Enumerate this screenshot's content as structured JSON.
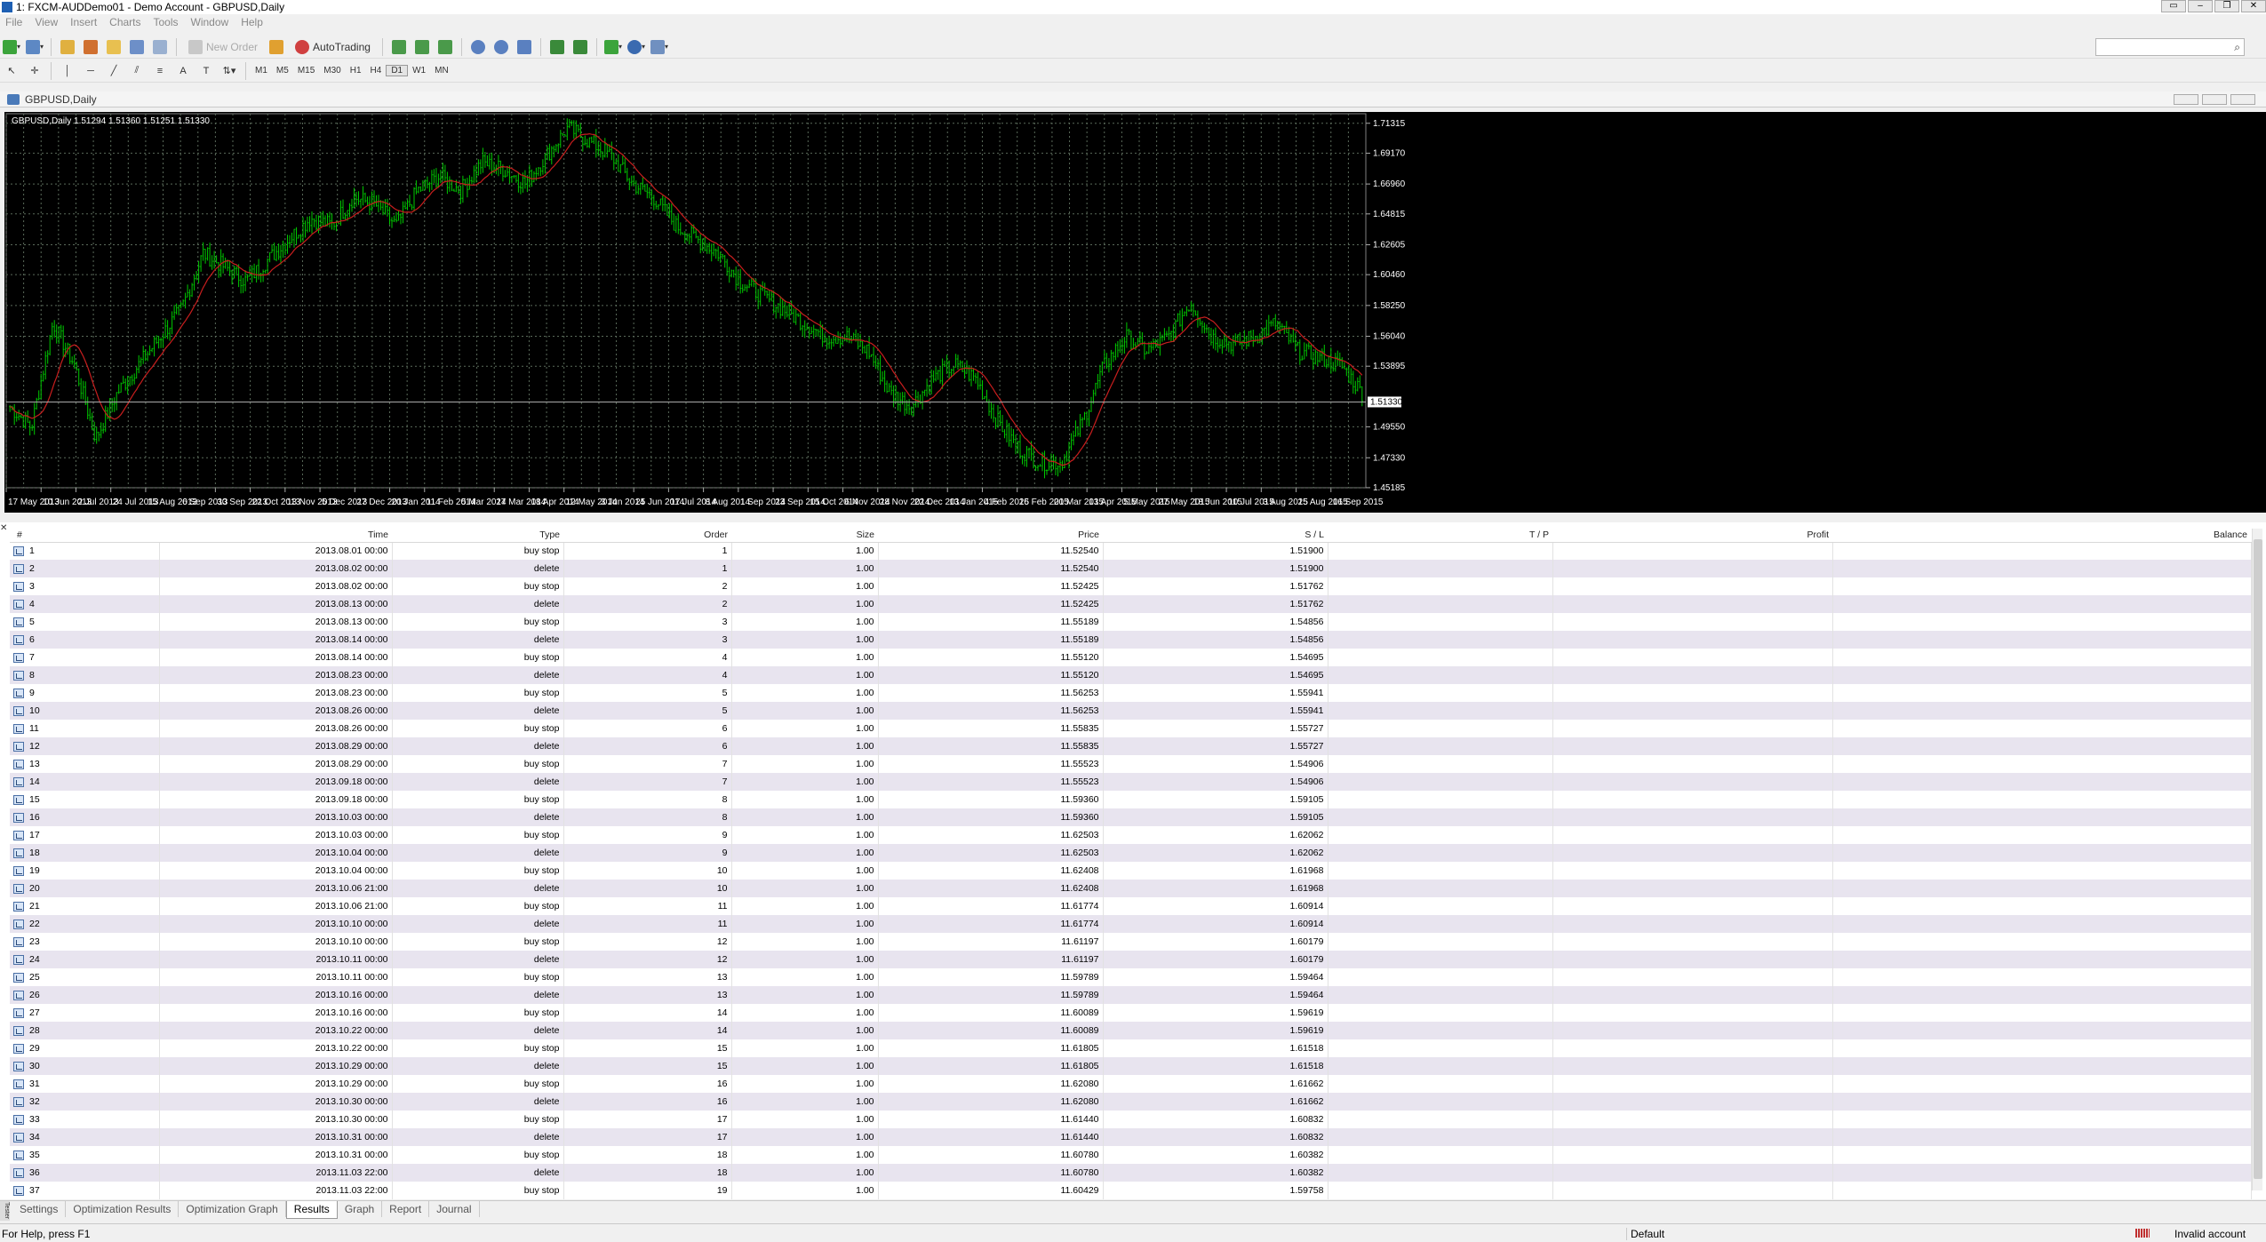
{
  "window": {
    "title": "1: FXCM-AUDDemo01 - Demo Account - GBPUSD,Daily",
    "buttons": [
      "▭",
      "–",
      "❐",
      "✕"
    ]
  },
  "menu": [
    "File",
    "View",
    "Insert",
    "Charts",
    "Tools",
    "Window",
    "Help"
  ],
  "toolbar1": {
    "new_order_label": "New Order",
    "autotrading_label": "AutoTrading"
  },
  "toolbar2": {
    "timeframes": [
      "M1",
      "M5",
      "M15",
      "M30",
      "H1",
      "H4",
      "D1",
      "W1",
      "MN"
    ],
    "active_timeframe": "D1"
  },
  "chart": {
    "window_title": "GBPUSD,Daily",
    "ohlc_label": "GBPUSD,Daily  1.51294 1.51360 1.51251 1.51330",
    "current_price": "1.51330",
    "price_labels": [
      "1.71315",
      "1.69170",
      "1.66960",
      "1.64815",
      "1.62605",
      "1.60460",
      "1.58250",
      "1.56040",
      "1.53895",
      "1.49550",
      "1.47330",
      "1.45185"
    ],
    "date_labels": [
      "17 May 2013",
      "10 Jun 2013",
      "2 Jul 2013",
      "24 Jul 2013",
      "15 Aug 2013",
      "6 Sep 2013",
      "30 Sep 2013",
      "22 Oct 2013",
      "13 Nov 2013",
      "5 Dec 2013",
      "27 Dec 2013",
      "20 Jan 2014",
      "11 Feb 2014",
      "5 Mar 2014",
      "27 Mar 2014",
      "18 Apr 2014",
      "12 May 2014",
      "3 Jun 2014",
      "25 Jun 2014",
      "17 Jul 2014",
      "8 Aug 2014",
      "1 Sep 2014",
      "23 Sep 2014",
      "15 Oct 2014",
      "6 Nov 2014",
      "28 Nov 2014",
      "22 Dec 2014",
      "13 Jan 2015",
      "4 Feb 2015",
      "26 Feb 2015",
      "20 Mar 2015",
      "13 Apr 2015",
      "5 May 2015",
      "27 May 2015",
      "18 Jun 2015",
      "10 Jul 2015",
      "3 Aug 2015",
      "25 Aug 2015",
      "16 Sep 2015"
    ],
    "price_min": 1.4518,
    "price_max": 1.72,
    "colors": {
      "background": "#000000",
      "bars": "#00c800",
      "ma_line": "#c81e1e",
      "grid": "#5a6a5a"
    },
    "series_keypoints": [
      1.51,
      1.495,
      1.57,
      1.54,
      1.487,
      1.52,
      1.54,
      1.56,
      1.58,
      1.62,
      1.61,
      1.6,
      1.615,
      1.63,
      1.645,
      1.64,
      1.66,
      1.655,
      1.64,
      1.665,
      1.675,
      1.665,
      1.685,
      1.68,
      1.67,
      1.69,
      1.71,
      1.7,
      1.69,
      1.67,
      1.66,
      1.64,
      1.63,
      1.62,
      1.6,
      1.59,
      1.58,
      1.57,
      1.56,
      1.56,
      1.55,
      1.52,
      1.51,
      1.53,
      1.54,
      1.53,
      1.5,
      1.48,
      1.47,
      1.47,
      1.5,
      1.54,
      1.56,
      1.55,
      1.56,
      1.585,
      1.56,
      1.555,
      1.56,
      1.57,
      1.55,
      1.545,
      1.54,
      1.52
    ]
  },
  "results": {
    "columns": [
      "#",
      "Time",
      "Type",
      "Order",
      "Size",
      "Price",
      "S / L",
      "T / P",
      "Profit",
      "Balance"
    ],
    "rows": [
      [
        "1",
        "2013.08.01 00:00",
        "buy stop",
        "1",
        "1.00",
        "11.52540",
        "1.51900",
        "",
        "",
        ""
      ],
      [
        "2",
        "2013.08.02 00:00",
        "delete",
        "1",
        "1.00",
        "11.52540",
        "1.51900",
        "",
        "",
        ""
      ],
      [
        "3",
        "2013.08.02 00:00",
        "buy stop",
        "2",
        "1.00",
        "11.52425",
        "1.51762",
        "",
        "",
        ""
      ],
      [
        "4",
        "2013.08.13 00:00",
        "delete",
        "2",
        "1.00",
        "11.52425",
        "1.51762",
        "",
        "",
        ""
      ],
      [
        "5",
        "2013.08.13 00:00",
        "buy stop",
        "3",
        "1.00",
        "11.55189",
        "1.54856",
        "",
        "",
        ""
      ],
      [
        "6",
        "2013.08.14 00:00",
        "delete",
        "3",
        "1.00",
        "11.55189",
        "1.54856",
        "",
        "",
        ""
      ],
      [
        "7",
        "2013.08.14 00:00",
        "buy stop",
        "4",
        "1.00",
        "11.55120",
        "1.54695",
        "",
        "",
        ""
      ],
      [
        "8",
        "2013.08.23 00:00",
        "delete",
        "4",
        "1.00",
        "11.55120",
        "1.54695",
        "",
        "",
        ""
      ],
      [
        "9",
        "2013.08.23 00:00",
        "buy stop",
        "5",
        "1.00",
        "11.56253",
        "1.55941",
        "",
        "",
        ""
      ],
      [
        "10",
        "2013.08.26 00:00",
        "delete",
        "5",
        "1.00",
        "11.56253",
        "1.55941",
        "",
        "",
        ""
      ],
      [
        "11",
        "2013.08.26 00:00",
        "buy stop",
        "6",
        "1.00",
        "11.55835",
        "1.55727",
        "",
        "",
        ""
      ],
      [
        "12",
        "2013.08.29 00:00",
        "delete",
        "6",
        "1.00",
        "11.55835",
        "1.55727",
        "",
        "",
        ""
      ],
      [
        "13",
        "2013.08.29 00:00",
        "buy stop",
        "7",
        "1.00",
        "11.55523",
        "1.54906",
        "",
        "",
        ""
      ],
      [
        "14",
        "2013.09.18 00:00",
        "delete",
        "7",
        "1.00",
        "11.55523",
        "1.54906",
        "",
        "",
        ""
      ],
      [
        "15",
        "2013.09.18 00:00",
        "buy stop",
        "8",
        "1.00",
        "11.59360",
        "1.59105",
        "",
        "",
        ""
      ],
      [
        "16",
        "2013.10.03 00:00",
        "delete",
        "8",
        "1.00",
        "11.59360",
        "1.59105",
        "",
        "",
        ""
      ],
      [
        "17",
        "2013.10.03 00:00",
        "buy stop",
        "9",
        "1.00",
        "11.62503",
        "1.62062",
        "",
        "",
        ""
      ],
      [
        "18",
        "2013.10.04 00:00",
        "delete",
        "9",
        "1.00",
        "11.62503",
        "1.62062",
        "",
        "",
        ""
      ],
      [
        "19",
        "2013.10.04 00:00",
        "buy stop",
        "10",
        "1.00",
        "11.62408",
        "1.61968",
        "",
        "",
        ""
      ],
      [
        "20",
        "2013.10.06 21:00",
        "delete",
        "10",
        "1.00",
        "11.62408",
        "1.61968",
        "",
        "",
        ""
      ],
      [
        "21",
        "2013.10.06 21:00",
        "buy stop",
        "11",
        "1.00",
        "11.61774",
        "1.60914",
        "",
        "",
        ""
      ],
      [
        "22",
        "2013.10.10 00:00",
        "delete",
        "11",
        "1.00",
        "11.61774",
        "1.60914",
        "",
        "",
        ""
      ],
      [
        "23",
        "2013.10.10 00:00",
        "buy stop",
        "12",
        "1.00",
        "11.61197",
        "1.60179",
        "",
        "",
        ""
      ],
      [
        "24",
        "2013.10.11 00:00",
        "delete",
        "12",
        "1.00",
        "11.61197",
        "1.60179",
        "",
        "",
        ""
      ],
      [
        "25",
        "2013.10.11 00:00",
        "buy stop",
        "13",
        "1.00",
        "11.59789",
        "1.59464",
        "",
        "",
        ""
      ],
      [
        "26",
        "2013.10.16 00:00",
        "delete",
        "13",
        "1.00",
        "11.59789",
        "1.59464",
        "",
        "",
        ""
      ],
      [
        "27",
        "2013.10.16 00:00",
        "buy stop",
        "14",
        "1.00",
        "11.60089",
        "1.59619",
        "",
        "",
        ""
      ],
      [
        "28",
        "2013.10.22 00:00",
        "delete",
        "14",
        "1.00",
        "11.60089",
        "1.59619",
        "",
        "",
        ""
      ],
      [
        "29",
        "2013.10.22 00:00",
        "buy stop",
        "15",
        "1.00",
        "11.61805",
        "1.61518",
        "",
        "",
        ""
      ],
      [
        "30",
        "2013.10.29 00:00",
        "delete",
        "15",
        "1.00",
        "11.61805",
        "1.61518",
        "",
        "",
        ""
      ],
      [
        "31",
        "2013.10.29 00:00",
        "buy stop",
        "16",
        "1.00",
        "11.62080",
        "1.61662",
        "",
        "",
        ""
      ],
      [
        "32",
        "2013.10.30 00:00",
        "delete",
        "16",
        "1.00",
        "11.62080",
        "1.61662",
        "",
        "",
        ""
      ],
      [
        "33",
        "2013.10.30 00:00",
        "buy stop",
        "17",
        "1.00",
        "11.61440",
        "1.60832",
        "",
        "",
        ""
      ],
      [
        "34",
        "2013.10.31 00:00",
        "delete",
        "17",
        "1.00",
        "11.61440",
        "1.60832",
        "",
        "",
        ""
      ],
      [
        "35",
        "2013.10.31 00:00",
        "buy stop",
        "18",
        "1.00",
        "11.60780",
        "1.60382",
        "",
        "",
        ""
      ],
      [
        "36",
        "2013.11.03 22:00",
        "delete",
        "18",
        "1.00",
        "11.60780",
        "1.60382",
        "",
        "",
        ""
      ],
      [
        "37",
        "2013.11.03 22:00",
        "buy stop",
        "19",
        "1.00",
        "11.60429",
        "1.59758",
        "",
        "",
        ""
      ]
    ]
  },
  "tabs": {
    "side_label": "Tester",
    "items": [
      "Settings",
      "Optimization Results",
      "Optimization Graph",
      "Results",
      "Graph",
      "Report",
      "Journal"
    ],
    "active": "Results"
  },
  "status": {
    "help": "For Help, press F1",
    "profile": "Default",
    "connection": "Invalid account"
  }
}
